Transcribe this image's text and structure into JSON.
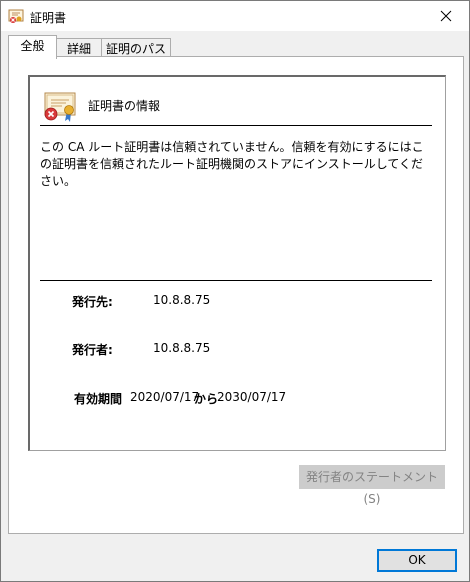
{
  "window": {
    "title": "証明書"
  },
  "tabs": [
    {
      "label": "全般"
    },
    {
      "label": "詳細"
    },
    {
      "label": "証明のパス"
    }
  ],
  "info": {
    "title": "証明書の情報",
    "warning": "この CA ルート証明書は信頼されていません。信頼を有効にするにはこの証明書を信頼されたルート証明機関のストアにインストールしてください。",
    "issued_to_label": "発行先:",
    "issued_to_value": "10.8.8.75",
    "issued_by_label": "発行者:",
    "issued_by_value": "10.8.8.75",
    "validity_label": "有効期間",
    "valid_from": "2020/07/17",
    "validity_to_word": "から",
    "valid_to": "2030/07/17"
  },
  "buttons": {
    "issuer_statement": "発行者のステートメント(S)",
    "ok": "OK"
  },
  "colors": {
    "accent": "#0078d7",
    "disabled_text": "#838383"
  }
}
